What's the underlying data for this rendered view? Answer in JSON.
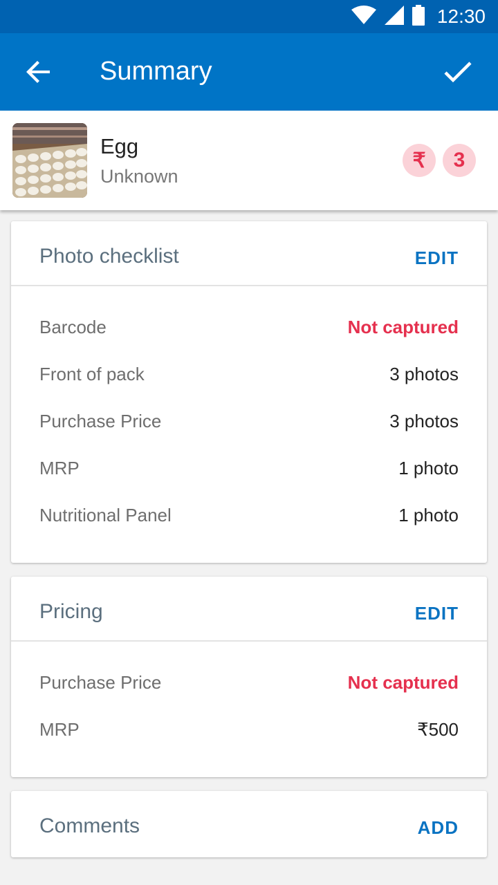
{
  "status_bar": {
    "time": "12:30",
    "icons": [
      "wifi-icon",
      "signal-icon",
      "battery-icon"
    ]
  },
  "app_bar": {
    "title": "Summary",
    "back_icon": "arrow-back-icon",
    "confirm_icon": "check-icon"
  },
  "product": {
    "name": "Egg",
    "brand": "Unknown",
    "price_badge": "₹",
    "count_badge": "3"
  },
  "photo_checklist": {
    "title": "Photo checklist",
    "action": "EDIT",
    "rows": [
      {
        "label": "Barcode",
        "value": "Not captured",
        "alert": true
      },
      {
        "label": "Front of pack",
        "value": "3 photos",
        "alert": false
      },
      {
        "label": "Purchase Price",
        "value": "3 photos",
        "alert": false
      },
      {
        "label": "MRP",
        "value": "1 photo",
        "alert": false
      },
      {
        "label": "Nutritional Panel",
        "value": "1 photo",
        "alert": false
      }
    ]
  },
  "pricing": {
    "title": "Pricing",
    "action": "EDIT",
    "rows": [
      {
        "label": "Purchase Price",
        "value": "Not captured",
        "alert": true
      },
      {
        "label": "MRP",
        "value": "₹500",
        "alert": false
      }
    ]
  },
  "comments": {
    "title": "Comments",
    "action": "ADD"
  },
  "colors": {
    "primary": "#0074c6",
    "status": "#0062b1",
    "accent": "#0a73c2",
    "alert": "#e5304e"
  }
}
